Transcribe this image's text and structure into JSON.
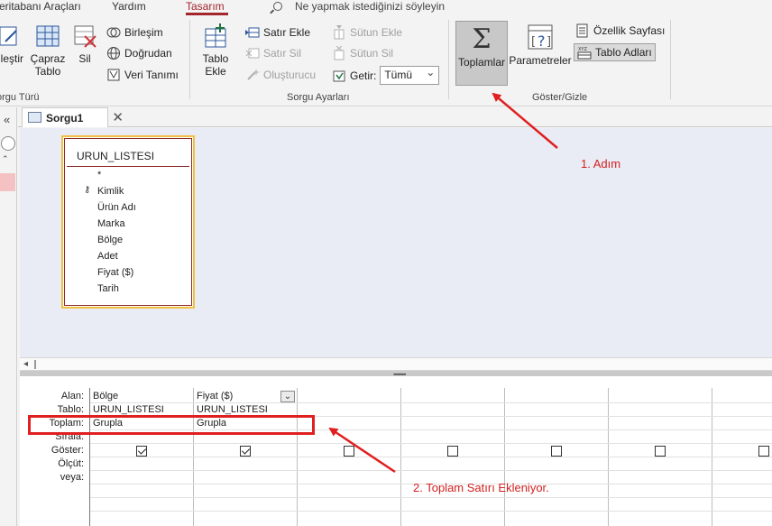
{
  "ribbon_tabs": [
    {
      "label": "eritabanı Araçları",
      "active": false
    },
    {
      "label": "Yardım",
      "active": false
    },
    {
      "label": "Tasarım",
      "active": true
    }
  ],
  "tell_me": "Ne yapmak istediğinizi söyleyin",
  "query_type": {
    "buttons": {
      "append": "lleştir",
      "crosstab": "Çapraz\nTablo",
      "delete": "Sil"
    },
    "small": {
      "union": "Birleşim",
      "pass_through": "Doğrudan",
      "data_definition": "Veri Tanımı"
    },
    "group_label": "orgu Türü"
  },
  "query_setup": {
    "add_table": "Tablo\nEkle",
    "insert_row": "Satır Ekle",
    "delete_row": "Satır Sil",
    "builder": "Oluşturucu",
    "insert_column": "Sütun Ekle",
    "delete_column": "Sütun Sil",
    "return_label": "Getir:",
    "return_value": "Tümü",
    "group_label": "Sorgu Ayarları"
  },
  "show_hide": {
    "totals": "Toplamlar",
    "parameters": "Parametreler",
    "property_sheet": "Özellik Sayfası",
    "table_names": "Tablo Adları",
    "group_label": "Göster/Gizle"
  },
  "document_tab": "Sorgu1",
  "table": {
    "name": "URUN_LISTESI",
    "fields": [
      "*",
      "Kimlik",
      "Ürün Adı",
      "Marka",
      "Bölge",
      "Adet",
      "Fiyat ($)",
      "Tarih"
    ]
  },
  "grid": {
    "row_labels": [
      "Alan:",
      "Tablo:",
      "Toplam:",
      "Sırala:",
      "Göster:",
      "Ölçüt:",
      "veya:"
    ],
    "columns": [
      {
        "field": "Bölge",
        "table": "URUN_LISTESI",
        "total": "Grupla",
        "show": true
      },
      {
        "field": "Fiyat ($)",
        "table": "URUN_LISTESI",
        "total": "Grupla",
        "show": true
      },
      {
        "field": "",
        "table": "",
        "total": "",
        "show": false
      },
      {
        "field": "",
        "table": "",
        "total": "",
        "show": false
      },
      {
        "field": "",
        "table": "",
        "total": "",
        "show": false
      },
      {
        "field": "",
        "table": "",
        "total": "",
        "show": false
      },
      {
        "field": "",
        "table": "",
        "total": "",
        "show": false
      }
    ]
  },
  "annotations": {
    "step1": "1. Adım",
    "step2": "2. Toplam Satırı Ekleniyor."
  },
  "colors": {
    "accent": "#a4262c",
    "annotation": "#e02020",
    "table_border": "#f0c040"
  }
}
